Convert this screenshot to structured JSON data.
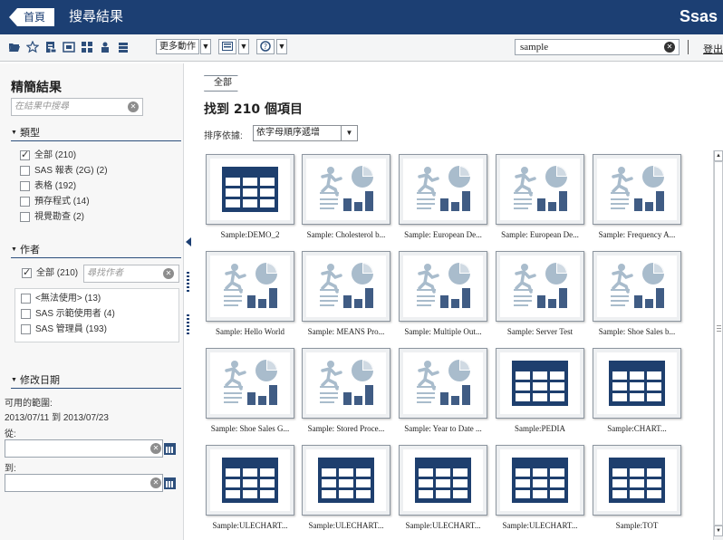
{
  "header": {
    "home_label": "首頁",
    "title": "搜尋結果",
    "brand": "Ssas"
  },
  "toolbar": {
    "icons": [
      "folder-open-icon",
      "star-icon",
      "report-icon",
      "table-icon",
      "grid-icon",
      "user-group-icon",
      "stack-icon"
    ],
    "more_actions_label": "更多動作",
    "view_icon": "view-grid-icon",
    "help_icon": "help-icon",
    "search_value": "sample",
    "logout_label": "登出"
  },
  "sidebar": {
    "title": "精簡結果",
    "search_placeholder": "在結果中搜尋",
    "type_section": {
      "heading": "類型",
      "items": [
        {
          "label": "全部 (210)",
          "checked": true
        },
        {
          "label": "SAS 報表 (2G) (2)",
          "checked": false
        },
        {
          "label": "表格 (192)",
          "checked": false
        },
        {
          "label": "預存程式 (14)",
          "checked": false
        },
        {
          "label": "視覺勘查 (2)",
          "checked": false
        }
      ]
    },
    "author_section": {
      "heading": "作者",
      "all_label": "全部 (210)",
      "all_checked": true,
      "search_placeholder": "尋找作者",
      "items": [
        {
          "label": "<無法使用> (13)",
          "checked": false
        },
        {
          "label": "SAS 示範使用者 (4)",
          "checked": false
        },
        {
          "label": "SAS 管理員 (193)",
          "checked": false
        }
      ]
    },
    "date_section": {
      "heading": "修改日期",
      "range_label": "可用的範圍:",
      "range_value": "2013/07/11 到 2013/07/23",
      "from_label": "從:",
      "to_label": "到:",
      "from_value": "",
      "to_value": ""
    }
  },
  "main": {
    "breadcrumb": "全部",
    "results_title": "找到 210 個項目",
    "sort_label": "排序依據:",
    "sort_value": "依字母順序遞增",
    "tiles": [
      {
        "label": "Sample:DEMO_2",
        "kind": "table"
      },
      {
        "label": "Sample: Cholesterol b...",
        "kind": "stored-process"
      },
      {
        "label": "Sample: European De...",
        "kind": "stored-process"
      },
      {
        "label": "Sample: European De...",
        "kind": "stored-process"
      },
      {
        "label": "Sample: Frequency A...",
        "kind": "stored-process"
      },
      {
        "label": "Sample: Hello World",
        "kind": "stored-process"
      },
      {
        "label": "Sample: MEANS Pro...",
        "kind": "stored-process"
      },
      {
        "label": "Sample: Multiple Out...",
        "kind": "stored-process"
      },
      {
        "label": "Sample: Server Test",
        "kind": "stored-process"
      },
      {
        "label": "Sample: Shoe Sales b...",
        "kind": "stored-process"
      },
      {
        "label": "Sample: Shoe Sales G...",
        "kind": "stored-process"
      },
      {
        "label": "Sample: Stored Proce...",
        "kind": "stored-process"
      },
      {
        "label": "Sample: Year to Date ...",
        "kind": "stored-process"
      },
      {
        "label": "Sample:PEDIA",
        "kind": "table"
      },
      {
        "label": "Sample:CHART...",
        "kind": "table"
      },
      {
        "label": "Sample:ULECHART...",
        "kind": "table"
      },
      {
        "label": "Sample:ULECHART...",
        "kind": "table"
      },
      {
        "label": "Sample:ULECHART...",
        "kind": "table"
      },
      {
        "label": "Sample:ULECHART...",
        "kind": "table"
      },
      {
        "label": "Sample:TOT",
        "kind": "table"
      }
    ]
  },
  "colors": {
    "header_bg": "#1c3f73",
    "accent": "#2d4f7c",
    "tile_dark": "#1e3f6e",
    "tile_light": "#a9bccc"
  }
}
